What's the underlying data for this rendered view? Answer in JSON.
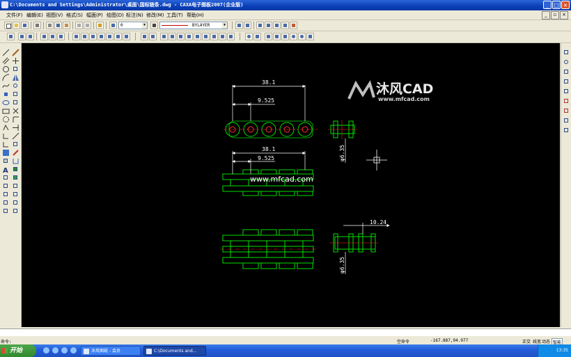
{
  "window": {
    "title": "C:\\Documents and Settings\\Administrator\\桌面\\国标链条.dwg - CAXA电子图板2007(企业版)",
    "minimize": "_",
    "maximize": "□",
    "close": "×"
  },
  "menu": [
    "文件(F)",
    "编辑(E)",
    "视图(V)",
    "格式(S)",
    "幅面(P)",
    "绘图(D)",
    "标注(N)",
    "修改(M)",
    "工具(T)",
    "帮助(H)"
  ],
  "toolbar": {
    "layer_value": "0",
    "linetype_value": "BYLAYER"
  },
  "drawing": {
    "dim_pitch_total_1": "38.1",
    "dim_pitch_1": "9.525",
    "dim_pitch_total_2": "38.1",
    "dim_pitch_2": "9.525",
    "dim_diameter_1": "φ6.35",
    "dim_diameter_2": "φ6.35",
    "dim_width": "10.24",
    "watermark_brand": "沐风CAD",
    "watermark_url": "www.mfcad.com",
    "watermark_center": "www.mfcad.com"
  },
  "status": {
    "cmd_label": "命令:",
    "cmd_state": "空命令",
    "coords": "-167.887,94.977",
    "ortho": "正交",
    "linewidth": "线宽",
    "dynamic": "动态",
    "snap": "智能"
  },
  "taskbar": {
    "start": "开始",
    "task1": "沐风图纸 - 会员",
    "task2": "C:\\Documents and...",
    "clock": "13:35"
  },
  "colors": {
    "canvas": "#000000",
    "geometry": "#00e000",
    "dimension": "#ffffff",
    "center": "#ff2020"
  }
}
